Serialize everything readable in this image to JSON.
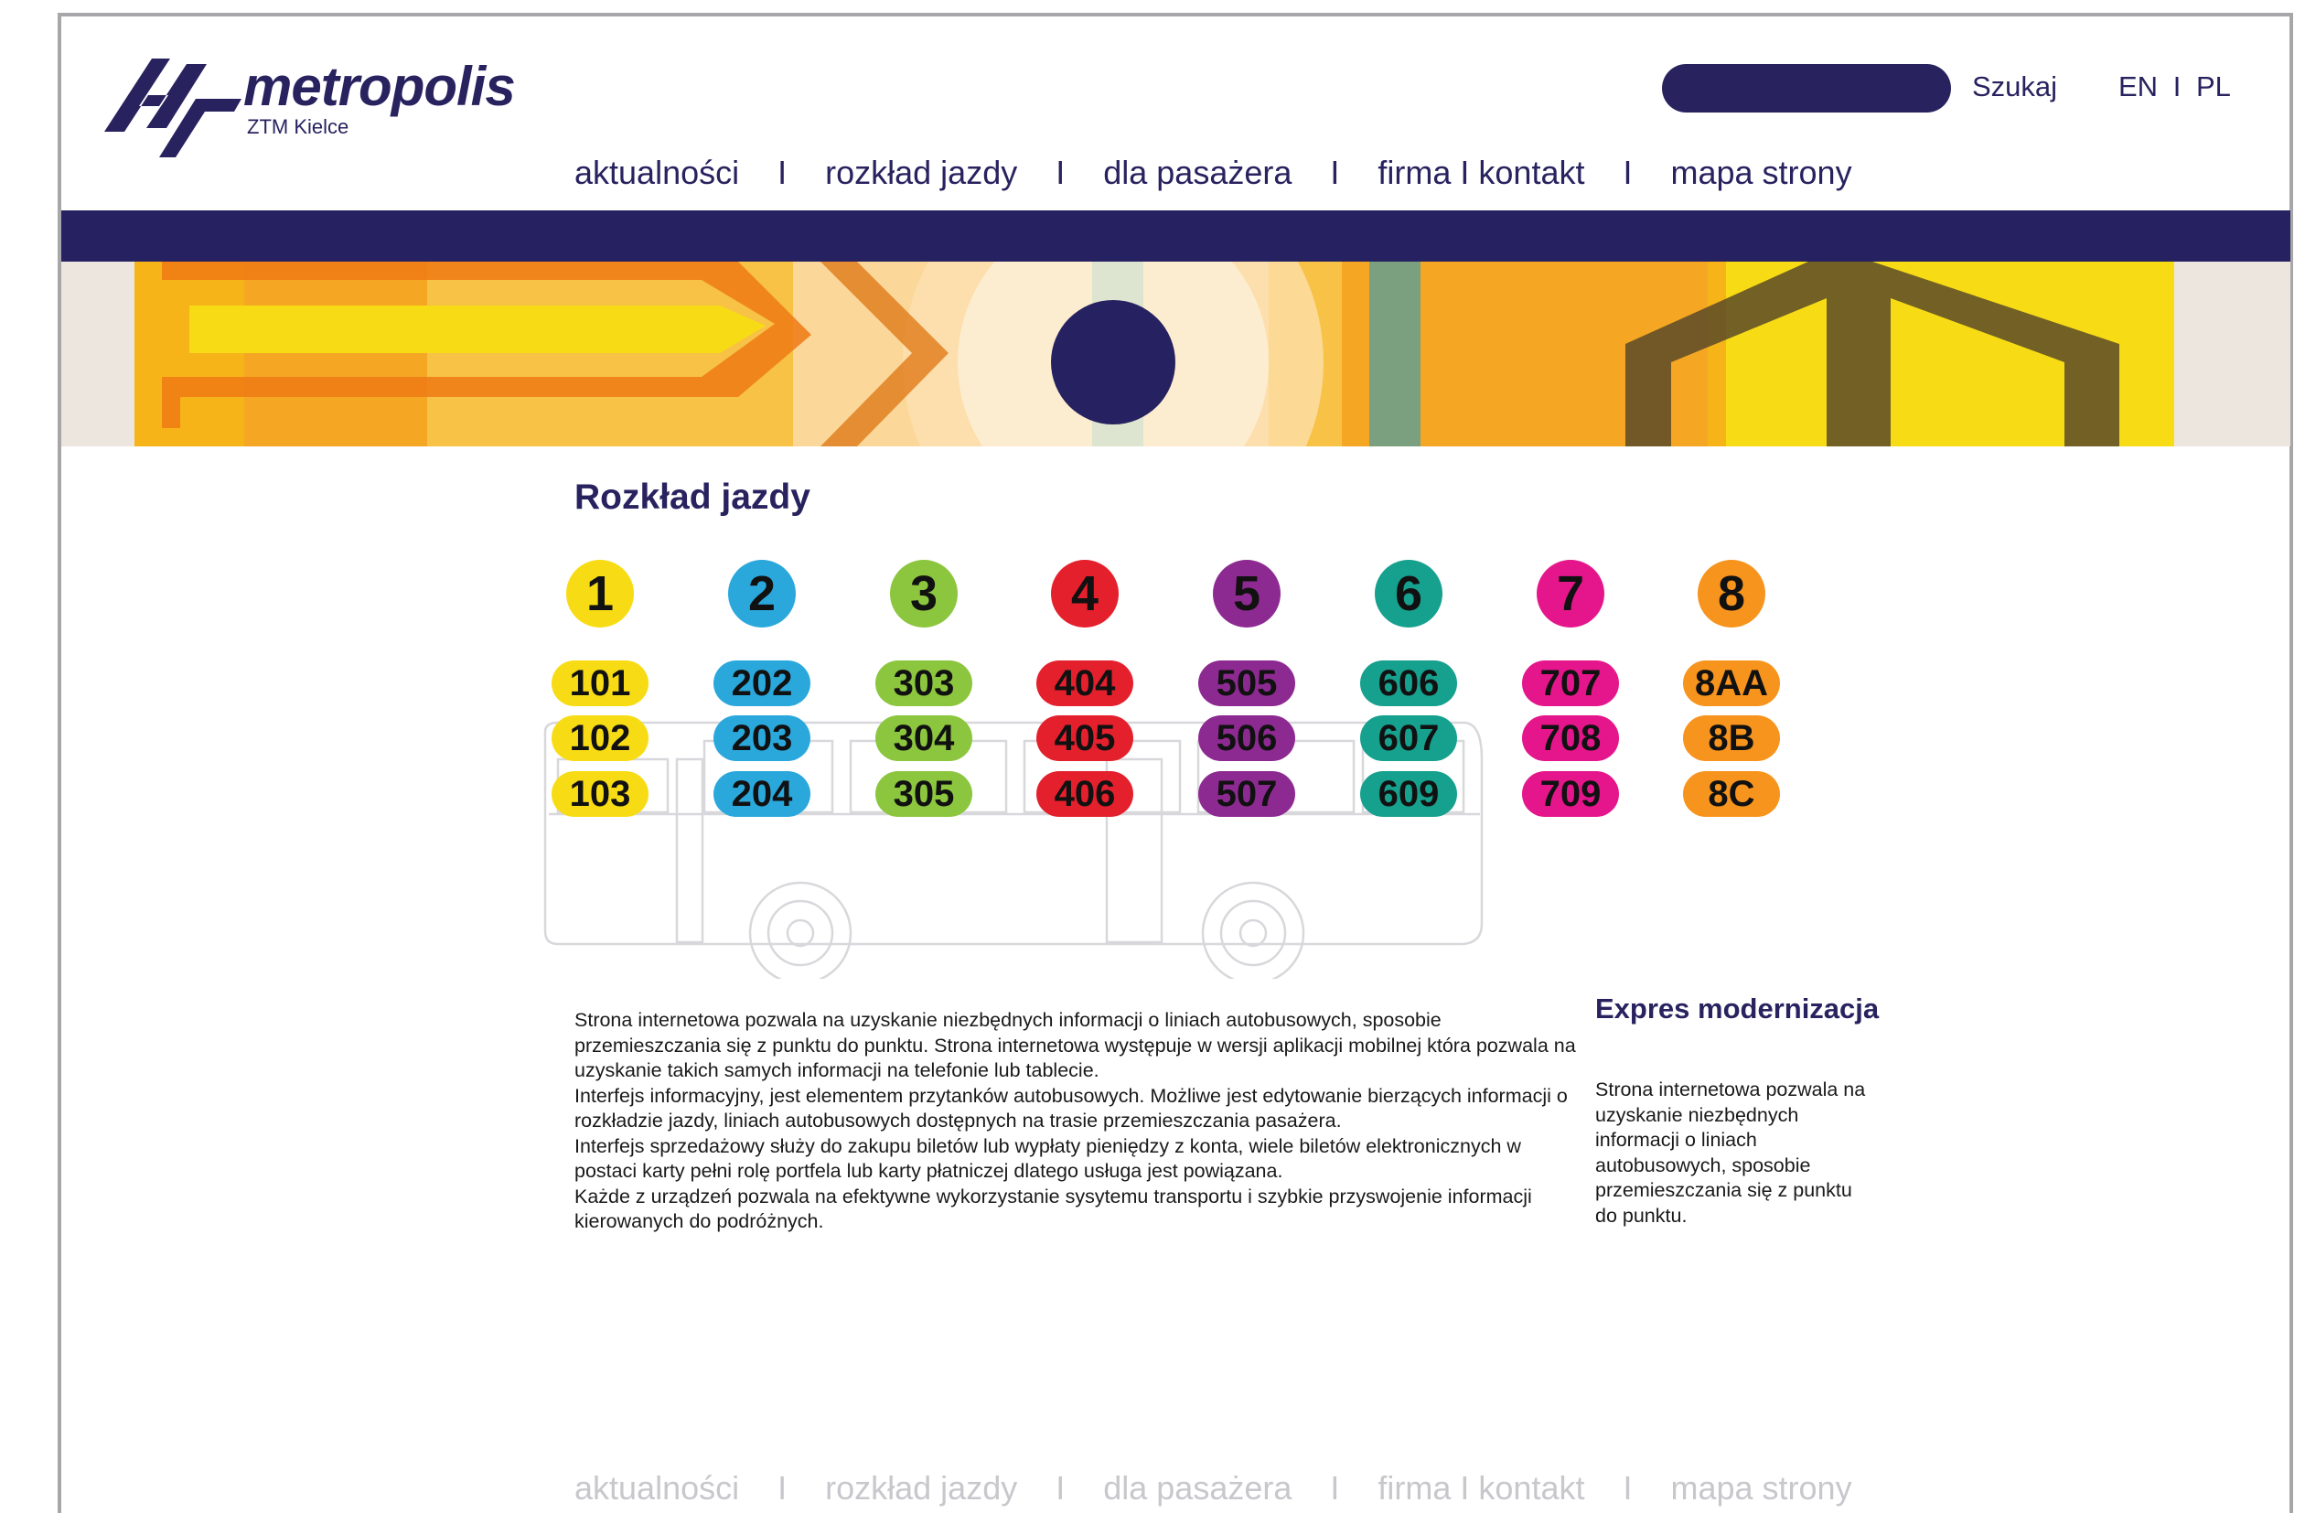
{
  "brand": {
    "name": "metropolis",
    "subtitle": "ZTM Kielce",
    "navy": "#262160"
  },
  "header": {
    "search_placeholder": "",
    "search_label": "Szukaj",
    "lang_en": "EN",
    "lang_sep": "I",
    "lang_pl": "PL"
  },
  "nav": {
    "items": [
      "aktualności",
      "rozkład jazdy",
      "dla pasażera",
      "firma I kontakt",
      "mapa strony"
    ],
    "separator": "I"
  },
  "main": {
    "title": "Rozkład jazdy",
    "lines": [
      {
        "number": "1",
        "color": "#f7dc15",
        "routes": [
          "101",
          "102",
          "103"
        ]
      },
      {
        "number": "2",
        "color": "#2aa8dc",
        "routes": [
          "202",
          "203",
          "204"
        ]
      },
      {
        "number": "3",
        "color": "#8cc63e",
        "routes": [
          "303",
          "304",
          "305"
        ]
      },
      {
        "number": "4",
        "color": "#e4202d",
        "routes": [
          "404",
          "405",
          "406"
        ]
      },
      {
        "number": "5",
        "color": "#8d2a91",
        "routes": [
          "505",
          "506",
          "507"
        ]
      },
      {
        "number": "6",
        "color": "#16a08e",
        "routes": [
          "606",
          "607",
          "609"
        ]
      },
      {
        "number": "7",
        "color": "#e5168b",
        "routes": [
          "707",
          "708",
          "709"
        ]
      },
      {
        "number": "8",
        "color": "#f7941d",
        "routes": [
          "8AA",
          "8B",
          "8C"
        ]
      }
    ],
    "description": [
      "Strona internetowa pozwala na uzyskanie niezbędnych informacji o liniach autobusowych, sposobie przemieszczania się z punktu do punktu. Strona internetowa występuje w wersji aplikacji mobilnej która pozwala na uzyskanie takich samych informacji na telefonie lub tablecie.",
      "Interfejs informacyjny, jest elementem przytanków autobusowych. Możliwe jest edytowanie bierzących informacji o rozkładzie jazdy, liniach autobusowych dostępnych na trasie przemieszczania pasażera.",
      "Interfejs sprzedażowy służy do zakupu biletów lub wypłaty pieniędzy z konta, wiele biletów elektronicznych w postaci karty pełni rolę portfela lub karty płatniczej dlatego usługa jest powiązana.",
      "Każde z urządzeń pozwala na efektywne wykorzystanie sysytemu transportu i szybkie przyswojenie informacji kierowanych do podróżnych."
    ]
  },
  "sidebar": {
    "title": "Expres modernizacja",
    "text": "Strona internetowa pozwala na uzyskanie niezbędnych informacji o liniach autobusowych, sposobie przemieszczania się z punktu do punktu."
  },
  "footer": {
    "items": [
      "aktualności",
      "rozkład jazdy",
      "dla pasażera",
      "firma I kontakt",
      "mapa strony"
    ],
    "separator": "I"
  }
}
